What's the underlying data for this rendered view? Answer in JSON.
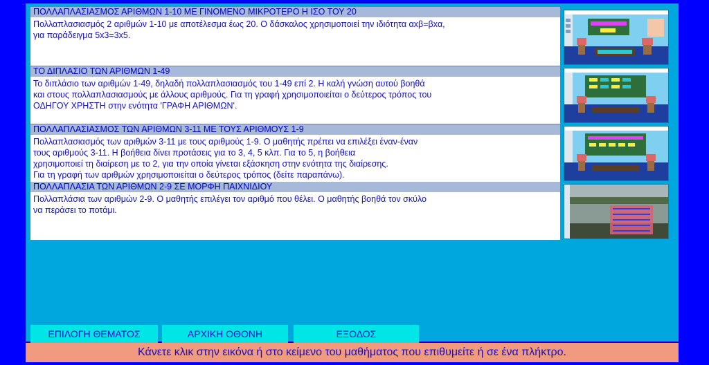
{
  "lessons": [
    {
      "title": "ΠΟΛΛΑΠΛΑΣΙΑΣΜΟΣ ΑΡΙΘΜΩΝ 1-10 ΜΕ ΓΙΝΟΜΕΝΟ ΜΙΚΡΟΤΕΡΟ Η ΙΣΟ ΤΟΥ 20",
      "lines": [
        "Πολλαπλασιασμός 2 αριθμών 1-10 με αποτέλεσμα έως 20. Ο δάσκαλος χρησιμοποιεί την ιδιότητα αxβ=βxα,",
        "για παράδειγμα 5x3=3x5."
      ]
    },
    {
      "title": "ΤΟ ΔΙΠΛΑΣΙΟ ΤΩΝ ΑΡΙΘΜΩΝ 1-49",
      "lines": [
        "Το διπλάσιο των αριθμών 1-49, δηλαδή πολλαπλασιασμός του 1-49 επί 2. Η καλή γνώση αυτού βοηθά",
        "και στους πολλαπλασιασμούς με άλλους αριθμούς. Για τη γραφή χρησιμοποιείται ο δεύτερος τρόπος του",
        "ΟΔΗΓΟΥ ΧΡΗΣΤΗ στην ενότητα 'ΓΡΑΦΗ ΑΡΙΘΜΩΝ'."
      ]
    },
    {
      "title": "ΠΟΛΛΑΠΛΑΣΙΑΣΜΟΣ ΤΩΝ ΑΡΙΘΜΩΝ 3-11 ΜΕ ΤΟΥΣ ΑΡΙΘΜΟΥΣ 1-9",
      "lines": [
        "Πολλαπλασιασμός των αριθμών 3-11 με τους αριθμούς 1-9. Ο μαθητής πρέπει να επιλέξει έναν-έναν",
        "τους αριθμούς 3-11. Η βοήθεια δίνει προτάσεις για το 3, 4, 5 κλπ. Για το 5, η βοήθεια",
        "χρησιμοποιεί τη διαίρεση με το 2, για την οποία γίνεται εξάσκηση στην ενότητα της διαίρεσης.",
        "Για τη γραφή των αριθμών χρησιμοποιείται ο δεύτερος τρόπος (δείτε παραπάνω)."
      ]
    },
    {
      "title": "ΠΟΛΛΑΠΛΑΣΙΑ ΤΩΝ ΑΡΙΘΜΩΝ 2-9 ΣΕ ΜΟΡΦΗ ΠΑΙΧΝΙΔΙΟΥ",
      "lines": [
        "Πολλαπλάσια των αριθμών 2-9. Ο μαθητής επιλέγει τον αριθμό που θέλει. Ο μαθητής βοηθά τον σκύλο",
        "να περάσει το ποτάμι."
      ]
    }
  ],
  "buttons": {
    "choose_topic": "ΕΠΙΛΟΓΗ ΘΕΜΑΤΟΣ",
    "home_screen": "ΑΡΧΙΚΗ ΟΘΟΝΗ",
    "exit": "ΕΞΟΔΟΣ"
  },
  "status": "Κάνετε κλικ στην εικόνα ή στο κείμενο του μαθήματος που επιθυμείτε ή σε ένα πλήκτρο.",
  "colors": {
    "page_background": "#0000ff",
    "panel": "#00a6de",
    "title_bar": "#a8b8d8",
    "text": "#1010c8",
    "button": "#00e5e5",
    "status_bar": "#f29a7f"
  }
}
